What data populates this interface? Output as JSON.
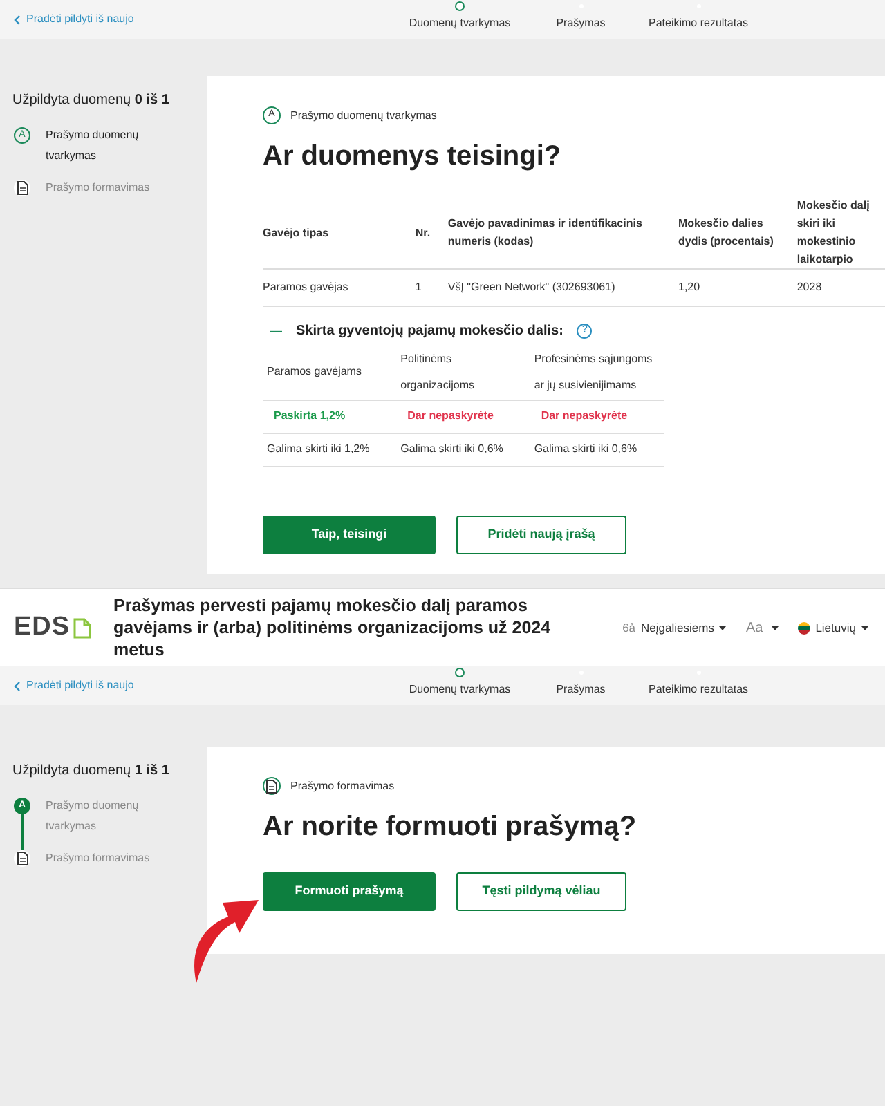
{
  "screens": [
    {
      "nav": {
        "back_link": "Pradėti pildyti iš naujo",
        "steps": [
          {
            "label": "Duomenų tvarkymas",
            "selected": true
          },
          {
            "label": "Prašymas",
            "selected": false
          },
          {
            "label": "Pateikimo rezultatas",
            "selected": false
          }
        ]
      },
      "sidebar": {
        "progress": "Užpildyta duomenų **0 iš 1**",
        "items": [
          {
            "label": "Prašymo duomenų tvarkymas",
            "badge": "A",
            "kind": "current"
          },
          {
            "label": "Prašymo formavimas",
            "kind": "pending"
          }
        ]
      },
      "card": {
        "section": {
          "label": "Prašymo duomenų tvarkymas",
          "badge": "A"
        },
        "title": "Ar duomenys teisingi?",
        "table": {
          "columns": [
            "Gavėjo tipas",
            "Nr.",
            "Gavėjo pavadinimas ir identifikacinis numeris (kodas)",
            "Mokesčio dalies dydis (procentais)",
            "Mokesčio dalį skiri iki mokestinio laikotarpio"
          ],
          "rows": [
            [
              "Paramos gavėjas",
              "1",
              "VšĮ \"Green Network\" (302693061)",
              "1,20",
              "2028"
            ]
          ]
        },
        "allocation": {
          "toggle": "—",
          "title": "Skirta gyventojų pajamų mokesčio dalis:",
          "help": "?",
          "expanded": true,
          "columns": [
            "Paramos gavėjams",
            "Politinėms organizacijoms",
            "Profesinėms sąjungoms ar jų susivienijimams"
          ],
          "statuses": [
            {
              "text": "Paskirta 1,2%",
              "kind": "assigned"
            },
            {
              "text": "Dar nepaskyrėte",
              "kind": "unassigned"
            },
            {
              "text": "Dar nepaskyrėte",
              "kind": "unassigned"
            }
          ],
          "limits": [
            "Galima skirti iki 1,2%",
            "Galima skirti iki 0,6%",
            "Galima skirti iki 0,6%"
          ]
        },
        "buttons": [
          {
            "label": "Taip, teisingi",
            "kind": "primary"
          },
          {
            "label": "Pridėti naują įrašą",
            "kind": "secondary"
          }
        ]
      }
    },
    {
      "header": {
        "logo": "EDS",
        "title": "Prašymas pervesti pajamų mokesčio dalį paramos gavėjams ir (arba) politinėms organizacijoms už 2024 metus",
        "accessibility_icon": "6ả",
        "accessibility": "Neįgaliesiems",
        "font_size": "Aa",
        "language": "Lietuvių"
      },
      "nav": {
        "back_link": "Pradėti pildyti iš naujo",
        "steps": [
          {
            "label": "Duomenų tvarkymas",
            "selected": true
          },
          {
            "label": "Prašymas",
            "selected": false
          },
          {
            "label": "Pateikimo rezultatas",
            "selected": false
          }
        ]
      },
      "sidebar": {
        "progress": "Užpildyta duomenų **1 iš 1**",
        "items": [
          {
            "label": "Prašymo duomenų tvarkymas",
            "badge": "A",
            "kind": "done"
          },
          {
            "label": "Prašymo formavimas",
            "kind": "pending"
          }
        ]
      },
      "card": {
        "section": {
          "label": "Prašymo formavimas"
        },
        "title": "Ar norite formuoti prašymą?",
        "buttons": [
          {
            "label": "Formuoti prašymą",
            "kind": "primary"
          },
          {
            "label": "Tęsti pildymą vėliau",
            "kind": "secondary"
          }
        ]
      }
    }
  ]
}
